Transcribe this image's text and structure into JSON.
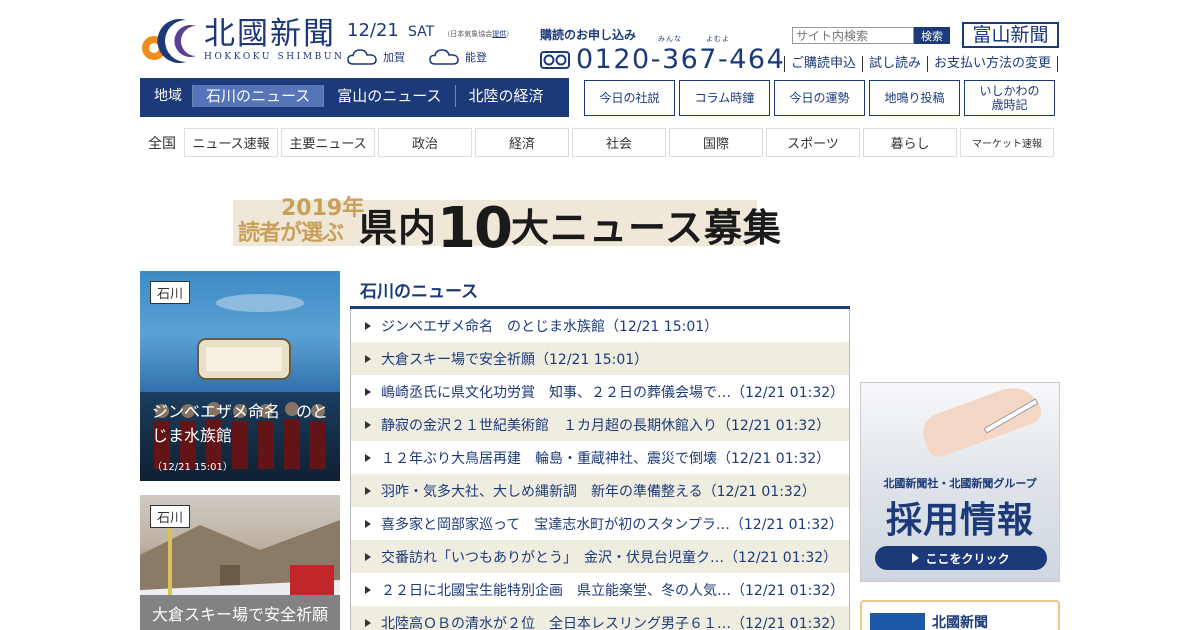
{
  "header": {
    "logo_name": "北國新聞",
    "logo_sub": "HOKKOKU SHIMBUN",
    "date": "12/21",
    "weekday": "SAT",
    "weather_note": "（日本気象協会",
    "weather_link": "提供",
    "weather_note_end": "）",
    "weather": [
      {
        "area": "加賀",
        "icon": "cloud-icon"
      },
      {
        "area": "能登",
        "icon": "cloud-icon"
      }
    ],
    "subscribe_label": "購読のお申し込み",
    "phone_ruby": "みんな　　　よむよ",
    "phone": "0120-367-464",
    "search_placeholder": "サイト内検索",
    "search_button": "検索",
    "toyama_link": "富山新聞",
    "service_links": [
      "ご購読申込",
      "試し読み",
      "お支払い方法の変更"
    ]
  },
  "region_nav": {
    "lead": "地域",
    "tabs": [
      "石川のニュース",
      "富山のニュース",
      "北陸の経済"
    ],
    "active_index": 0
  },
  "top_buttons": [
    "今日の社説",
    "コラム時鐘",
    "今日の運勢",
    "地鳴り投稿",
    "いしかわの\n歳時記"
  ],
  "category_nav": {
    "lead": "全国",
    "items": [
      "ニュース速報",
      "主要ニュース",
      "政治",
      "経済",
      "社会",
      "国際",
      "スポーツ",
      "暮らし",
      "マーケット速報"
    ]
  },
  "banner": {
    "year": "2019年",
    "readers": "読者が選ぶ",
    "title_pre": "県内",
    "title_num": "10",
    "title_post": "大ニュース募集"
  },
  "photos": [
    {
      "tag": "石川",
      "title": "ジンベエザメ命名　のとじま水族館",
      "time": "（12/21 15:01）"
    },
    {
      "tag": "石川",
      "title": "大倉スキー場で安全祈願",
      "time": ""
    }
  ],
  "news": {
    "heading": "石川のニュース",
    "items": [
      "ジンベエザメ命名　のとじま水族館（12/21 15:01）",
      "大倉スキー場で安全祈願（12/21 15:01）",
      "嶋崎丞氏に県文化功労賞　知事、２２日の葬儀会場で…（12/21 01:32）",
      "静寂の金沢２１世紀美術館　１カ月超の長期休館入り（12/21 01:32）",
      "１２年ぶり大鳥居再建　輪島・重蔵神社、震災で倒壊（12/21 01:32）",
      "羽咋・気多大社、大しめ縄新調　新年の準備整える（12/21 01:32）",
      "喜多家と岡部家巡って　宝達志水町が初のスタンプラ…（12/21 01:32）",
      "交番訪れ「いつもありがとう」　金沢・伏見台児童ク…（12/21 01:32）",
      "２２日に北國宝生能特別企画　県立能楽堂、冬の人気…（12/21 01:32）",
      "北陸高ＯＢの清水が２位　全日本レスリング男子６１…（12/21 01:32）"
    ]
  },
  "recruit_ad": {
    "org": "北國新聞社・北國新聞グループ",
    "title": "採用情報",
    "button": "ここをクリック"
  },
  "bottom_box": {
    "label": "北國新聞"
  },
  "colors": {
    "brand_navy": "#1c3a7a",
    "active_tab": "#5575b8",
    "row_stripe": "#eeede0",
    "banner_gold": "#c9a05a"
  }
}
